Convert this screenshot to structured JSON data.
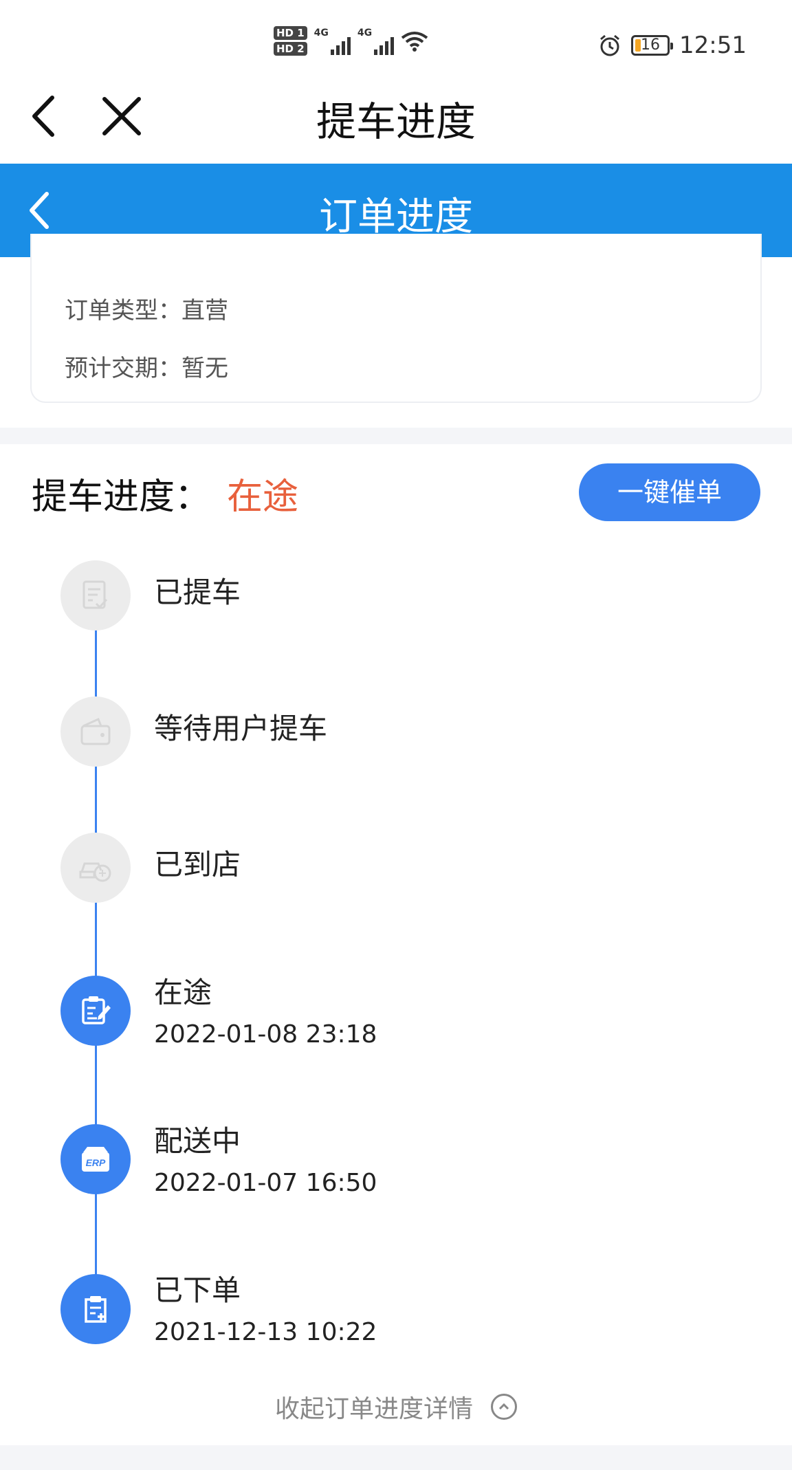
{
  "status_bar": {
    "hd1": "HD 1",
    "hd2": "HD 2",
    "net1": "4G",
    "net2": "4G",
    "battery": "16",
    "time": "12:51"
  },
  "top_nav": {
    "title": "提车进度"
  },
  "header": {
    "title": "订单进度"
  },
  "order_info": {
    "type_label": "订单类型：",
    "type_value": "直营",
    "delivery_label": "预计交期：",
    "delivery_value": "暂无"
  },
  "progress": {
    "label": "提车进度：",
    "status": "在途",
    "status_color": "#e8603c",
    "urge_button": "一键催单",
    "steps": [
      {
        "title": "已提车",
        "time": "",
        "done": false,
        "icon": "document-check-icon"
      },
      {
        "title": "等待用户提车",
        "time": "",
        "done": false,
        "icon": "wallet-icon"
      },
      {
        "title": "已到店",
        "time": "",
        "done": false,
        "icon": "car-store-icon"
      },
      {
        "title": "在途",
        "time": "2022-01-08 23:18",
        "done": true,
        "icon": "edit-document-icon"
      },
      {
        "title": "配送中",
        "time": "2022-01-07 16:50",
        "done": true,
        "icon": "erp-box-icon",
        "icon_text": "ERP"
      },
      {
        "title": "已下单",
        "time": "2021-12-13 10:22",
        "done": true,
        "icon": "clipboard-add-icon"
      }
    ],
    "collapse_text": "收起订单进度详情"
  },
  "colors": {
    "primary": "#1a8ee6",
    "accent": "#3a82f0",
    "inactive": "#ececec"
  }
}
